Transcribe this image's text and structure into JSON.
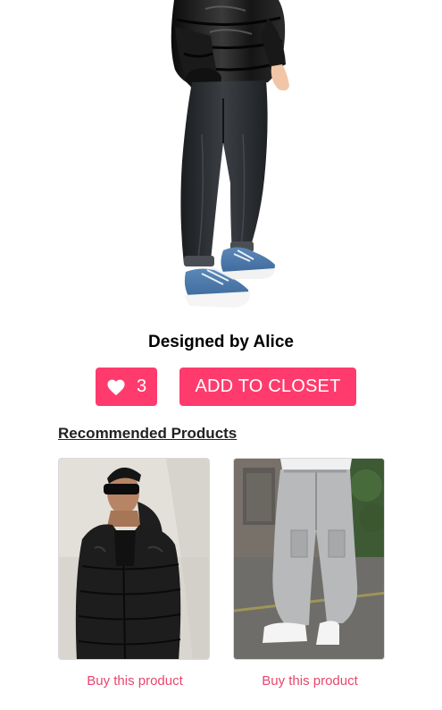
{
  "designer": {
    "text": "Designed by Alice"
  },
  "actions": {
    "like_count": "3",
    "add_to_closet_label": "ADD TO CLOSET"
  },
  "recommended": {
    "heading": "Recommended Products",
    "products": [
      {
        "image_icon": "black-puffer-jacket-photo",
        "link_label": "Buy this product"
      },
      {
        "image_icon": "grey-cargo-pants-photo",
        "link_label": "Buy this product"
      }
    ]
  },
  "colors": {
    "accent": "#ff3b6e",
    "link": "#e8466e",
    "text": "#000000"
  }
}
